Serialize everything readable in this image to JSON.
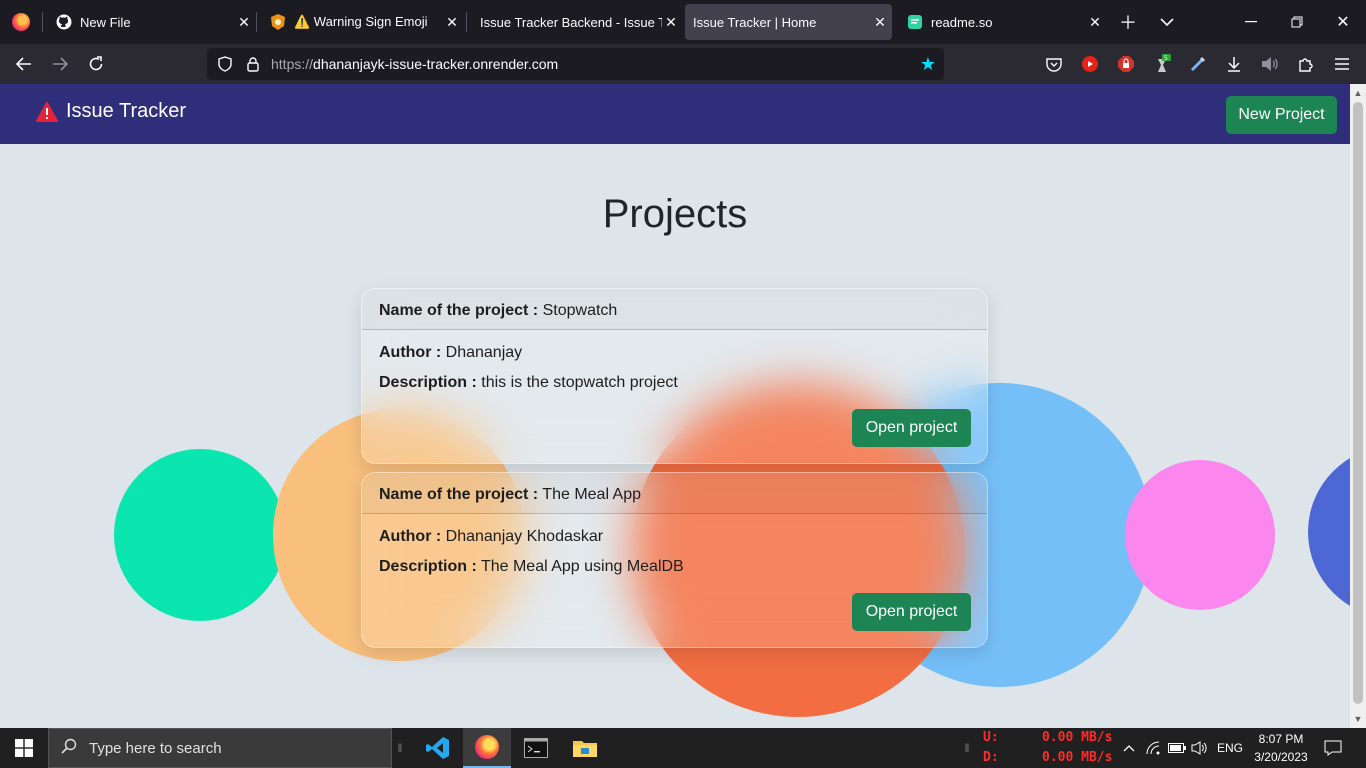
{
  "browser": {
    "tabs": [
      {
        "title": "New File",
        "icon": "github-icon",
        "active": false
      },
      {
        "title": "⚠️ Warning Sign Emoji",
        "icon": "emoji-site-icon",
        "active": false
      },
      {
        "title": "Issue Tracker Backend - Issue Tracker",
        "icon": "none",
        "active": false
      },
      {
        "title": "Issue Tracker | Home",
        "icon": "none",
        "active": true
      },
      {
        "title": "readme.so",
        "icon": "readme-icon",
        "active": false
      }
    ],
    "url_scheme": "https://",
    "url_host": "dhananjayk-issue-tracker.onrender.com",
    "extension_badge": "5"
  },
  "app": {
    "brand": "Issue Tracker",
    "new_project_label": "New Project",
    "heading": "Projects",
    "accent_color": "#1d8553",
    "navbar_color": "#2f2e7a"
  },
  "labels": {
    "name": "Name of the project :",
    "author": "Author :",
    "description": "Description :"
  },
  "projects": [
    {
      "name": "Stopwatch",
      "author": "Dhananjay",
      "description": "this is the stopwatch project",
      "button": "Open project"
    },
    {
      "name": "The Meal App",
      "author": "Dhananjay Khodaskar",
      "description": "The Meal App using MealDB",
      "button": "Open project"
    }
  ],
  "taskbar": {
    "search_placeholder": "Type here to search",
    "net_up_label": "U:",
    "net_up_value": "0.00 MB/s",
    "net_down_label": "D:",
    "net_down_value": "0.00 MB/s",
    "language": "ENG",
    "time": "8:07 PM",
    "date": "3/20/2023"
  }
}
